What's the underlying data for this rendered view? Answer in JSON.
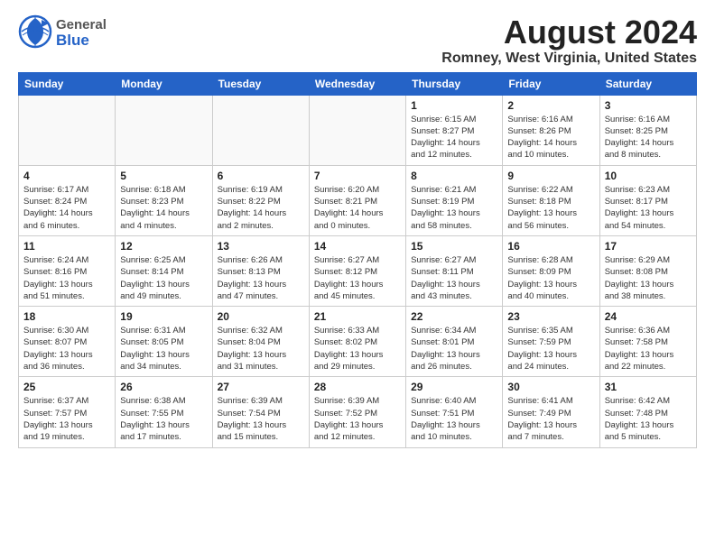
{
  "logo": {
    "general": "General",
    "blue": "Blue"
  },
  "title": "August 2024",
  "subtitle": "Romney, West Virginia, United States",
  "days_header": [
    "Sunday",
    "Monday",
    "Tuesday",
    "Wednesday",
    "Thursday",
    "Friday",
    "Saturday"
  ],
  "weeks": [
    [
      {
        "day": "",
        "info": ""
      },
      {
        "day": "",
        "info": ""
      },
      {
        "day": "",
        "info": ""
      },
      {
        "day": "",
        "info": ""
      },
      {
        "day": "1",
        "info": "Sunrise: 6:15 AM\nSunset: 8:27 PM\nDaylight: 14 hours\nand 12 minutes."
      },
      {
        "day": "2",
        "info": "Sunrise: 6:16 AM\nSunset: 8:26 PM\nDaylight: 14 hours\nand 10 minutes."
      },
      {
        "day": "3",
        "info": "Sunrise: 6:16 AM\nSunset: 8:25 PM\nDaylight: 14 hours\nand 8 minutes."
      }
    ],
    [
      {
        "day": "4",
        "info": "Sunrise: 6:17 AM\nSunset: 8:24 PM\nDaylight: 14 hours\nand 6 minutes."
      },
      {
        "day": "5",
        "info": "Sunrise: 6:18 AM\nSunset: 8:23 PM\nDaylight: 14 hours\nand 4 minutes."
      },
      {
        "day": "6",
        "info": "Sunrise: 6:19 AM\nSunset: 8:22 PM\nDaylight: 14 hours\nand 2 minutes."
      },
      {
        "day": "7",
        "info": "Sunrise: 6:20 AM\nSunset: 8:21 PM\nDaylight: 14 hours\nand 0 minutes."
      },
      {
        "day": "8",
        "info": "Sunrise: 6:21 AM\nSunset: 8:19 PM\nDaylight: 13 hours\nand 58 minutes."
      },
      {
        "day": "9",
        "info": "Sunrise: 6:22 AM\nSunset: 8:18 PM\nDaylight: 13 hours\nand 56 minutes."
      },
      {
        "day": "10",
        "info": "Sunrise: 6:23 AM\nSunset: 8:17 PM\nDaylight: 13 hours\nand 54 minutes."
      }
    ],
    [
      {
        "day": "11",
        "info": "Sunrise: 6:24 AM\nSunset: 8:16 PM\nDaylight: 13 hours\nand 51 minutes."
      },
      {
        "day": "12",
        "info": "Sunrise: 6:25 AM\nSunset: 8:14 PM\nDaylight: 13 hours\nand 49 minutes."
      },
      {
        "day": "13",
        "info": "Sunrise: 6:26 AM\nSunset: 8:13 PM\nDaylight: 13 hours\nand 47 minutes."
      },
      {
        "day": "14",
        "info": "Sunrise: 6:27 AM\nSunset: 8:12 PM\nDaylight: 13 hours\nand 45 minutes."
      },
      {
        "day": "15",
        "info": "Sunrise: 6:27 AM\nSunset: 8:11 PM\nDaylight: 13 hours\nand 43 minutes."
      },
      {
        "day": "16",
        "info": "Sunrise: 6:28 AM\nSunset: 8:09 PM\nDaylight: 13 hours\nand 40 minutes."
      },
      {
        "day": "17",
        "info": "Sunrise: 6:29 AM\nSunset: 8:08 PM\nDaylight: 13 hours\nand 38 minutes."
      }
    ],
    [
      {
        "day": "18",
        "info": "Sunrise: 6:30 AM\nSunset: 8:07 PM\nDaylight: 13 hours\nand 36 minutes."
      },
      {
        "day": "19",
        "info": "Sunrise: 6:31 AM\nSunset: 8:05 PM\nDaylight: 13 hours\nand 34 minutes."
      },
      {
        "day": "20",
        "info": "Sunrise: 6:32 AM\nSunset: 8:04 PM\nDaylight: 13 hours\nand 31 minutes."
      },
      {
        "day": "21",
        "info": "Sunrise: 6:33 AM\nSunset: 8:02 PM\nDaylight: 13 hours\nand 29 minutes."
      },
      {
        "day": "22",
        "info": "Sunrise: 6:34 AM\nSunset: 8:01 PM\nDaylight: 13 hours\nand 26 minutes."
      },
      {
        "day": "23",
        "info": "Sunrise: 6:35 AM\nSunset: 7:59 PM\nDaylight: 13 hours\nand 24 minutes."
      },
      {
        "day": "24",
        "info": "Sunrise: 6:36 AM\nSunset: 7:58 PM\nDaylight: 13 hours\nand 22 minutes."
      }
    ],
    [
      {
        "day": "25",
        "info": "Sunrise: 6:37 AM\nSunset: 7:57 PM\nDaylight: 13 hours\nand 19 minutes."
      },
      {
        "day": "26",
        "info": "Sunrise: 6:38 AM\nSunset: 7:55 PM\nDaylight: 13 hours\nand 17 minutes."
      },
      {
        "day": "27",
        "info": "Sunrise: 6:39 AM\nSunset: 7:54 PM\nDaylight: 13 hours\nand 15 minutes."
      },
      {
        "day": "28",
        "info": "Sunrise: 6:39 AM\nSunset: 7:52 PM\nDaylight: 13 hours\nand 12 minutes."
      },
      {
        "day": "29",
        "info": "Sunrise: 6:40 AM\nSunset: 7:51 PM\nDaylight: 13 hours\nand 10 minutes."
      },
      {
        "day": "30",
        "info": "Sunrise: 6:41 AM\nSunset: 7:49 PM\nDaylight: 13 hours\nand 7 minutes."
      },
      {
        "day": "31",
        "info": "Sunrise: 6:42 AM\nSunset: 7:48 PM\nDaylight: 13 hours\nand 5 minutes."
      }
    ]
  ]
}
